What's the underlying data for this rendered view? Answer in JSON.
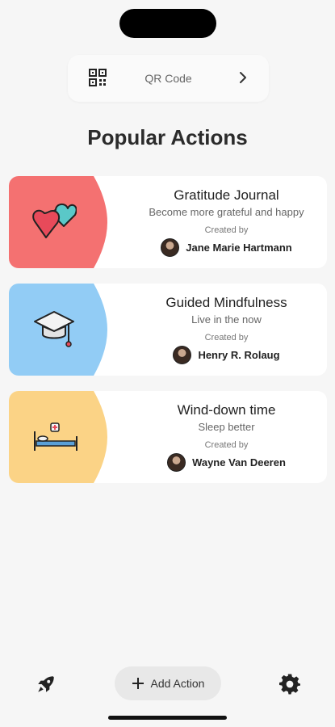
{
  "qr_bar": {
    "label": "QR Code",
    "icon": "qr-code-icon"
  },
  "page_title": "Popular Actions",
  "cards": [
    {
      "title": "Gratitude Journal",
      "subtitle": "Become more grateful and happy",
      "created_by_label": "Created by",
      "author": "Jane Marie Hartmann",
      "color": "#f47171",
      "icon": "hearts-icon"
    },
    {
      "title": "Guided Mindfulness",
      "subtitle": "Live in the now",
      "created_by_label": "Created by",
      "author": "Henry R. Rolaug",
      "color": "#92ccf5",
      "icon": "graduation-cap-icon"
    },
    {
      "title": "Wind-down time",
      "subtitle": "Sleep better",
      "created_by_label": "Created by",
      "author": "Wayne Van Deeren",
      "color": "#fbd386",
      "icon": "hospital-bed-icon"
    }
  ],
  "bottom_bar": {
    "add_label": "Add Action",
    "left_icon": "rocket-icon",
    "right_icon": "gear-icon"
  }
}
